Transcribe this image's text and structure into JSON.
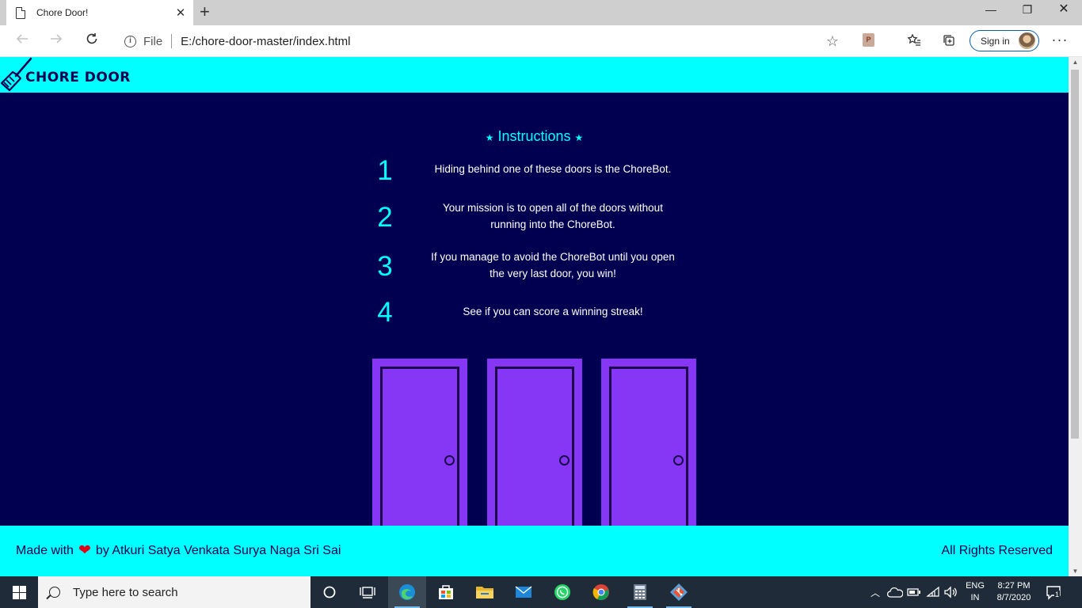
{
  "browser": {
    "tab": {
      "title": "Chore Door!"
    },
    "window_controls": {
      "minimize": "—",
      "restore": "❐",
      "close": "✕"
    },
    "address": {
      "scheme_label": "File",
      "url": "E:/chore-door-master/index.html"
    },
    "sign_in_label": "Sign in",
    "extension_badge": "P"
  },
  "site": {
    "brand": "CHORE DOOR",
    "instructions_title": "Instructions",
    "steps": [
      {
        "number": "1",
        "text": "Hiding behind one of these doors is the ChoreBot."
      },
      {
        "number": "2",
        "text": "Your mission is to open all of the doors without running into the ChoreBot."
      },
      {
        "number": "3",
        "text": "If you manage to avoid the ChoreBot until you open the very last door, you win!"
      },
      {
        "number": "4",
        "text": "See if you can score a winning streak!"
      }
    ],
    "doors": [
      "door-1",
      "door-2",
      "door-3"
    ],
    "footer": {
      "made_with": "Made with",
      "by_line": "by Atkuri Satya Venkata Surya Naga Sri Sai",
      "rights": "All Rights Reserved"
    },
    "colors": {
      "cyan": "#00ffff",
      "navy": "#010050",
      "door_purple": "#8636f5",
      "heart": "#e0001a"
    }
  },
  "taskbar": {
    "search_placeholder": "Type here to search",
    "pinned_apps": [
      "cortana",
      "task-view",
      "edge",
      "store",
      "file-explorer",
      "mail",
      "whatsapp",
      "chrome",
      "calculator",
      "git"
    ],
    "language": {
      "line1": "ENG",
      "line2": "IN"
    },
    "clock": {
      "time": "8:27 PM",
      "date": "8/7/2020"
    },
    "notification_count": "1"
  }
}
